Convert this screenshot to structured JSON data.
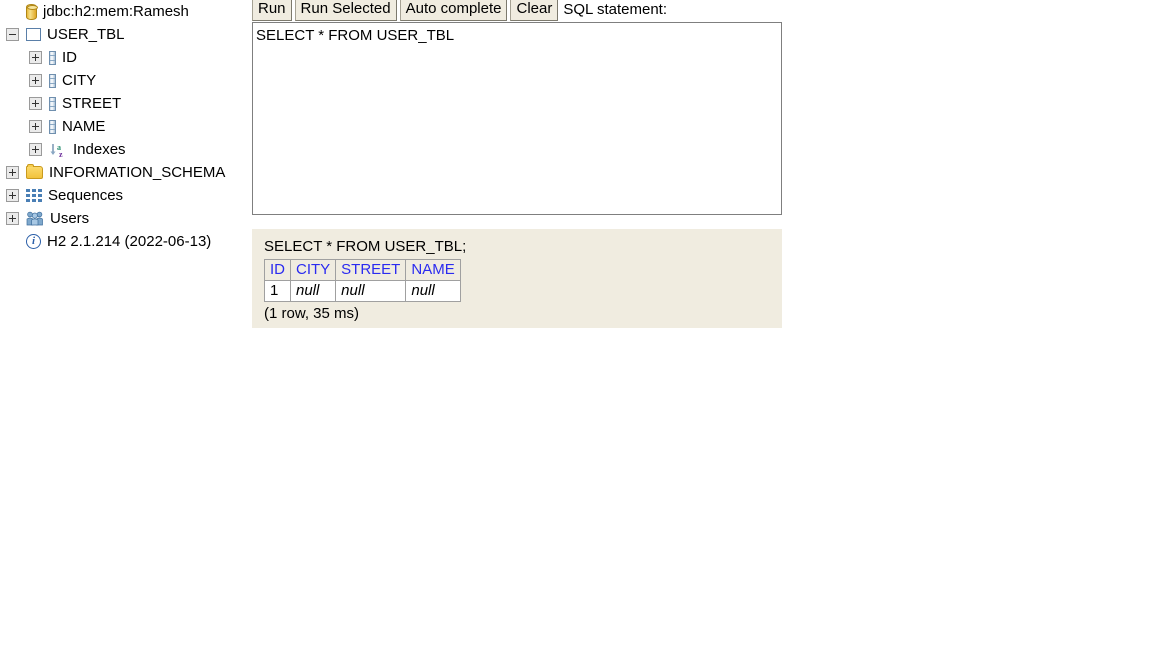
{
  "sidebar": {
    "tree": [
      {
        "label": "jdbc:h2:mem:Ramesh",
        "icon": "database-icon",
        "level": 0,
        "toggle": "none"
      },
      {
        "label": "USER_TBL",
        "icon": "table-icon",
        "level": 1,
        "toggle": "minus"
      },
      {
        "label": "ID",
        "icon": "column-icon",
        "level": 2,
        "toggle": "plus"
      },
      {
        "label": "CITY",
        "icon": "column-icon",
        "level": 2,
        "toggle": "plus"
      },
      {
        "label": "STREET",
        "icon": "column-icon",
        "level": 2,
        "toggle": "plus"
      },
      {
        "label": "NAME",
        "icon": "column-icon",
        "level": 2,
        "toggle": "plus"
      },
      {
        "label": "Indexes",
        "icon": "index-sort-icon",
        "level": 2,
        "toggle": "plus"
      },
      {
        "label": "INFORMATION_SCHEMA",
        "icon": "folder-icon",
        "level": 1,
        "toggle": "plus"
      },
      {
        "label": "Sequences",
        "icon": "sequences-icon",
        "level": 1,
        "toggle": "plus"
      },
      {
        "label": "Users",
        "icon": "users-icon",
        "level": 1,
        "toggle": "plus"
      },
      {
        "label": "H2 2.1.214 (2022-06-13)",
        "icon": "info-icon",
        "level": 1,
        "toggle": "none"
      }
    ]
  },
  "toolbar": {
    "run_label": "Run",
    "run_selected_label": "Run Selected",
    "auto_complete_label": "Auto complete",
    "clear_label": "Clear",
    "sql_statement_label": "SQL statement:"
  },
  "editor": {
    "sql": "SELECT * FROM USER_TBL"
  },
  "results": {
    "query": "SELECT * FROM USER_TBL;",
    "columns": [
      "ID",
      "CITY",
      "STREET",
      "NAME"
    ],
    "rows": [
      [
        "1",
        "null",
        "null",
        "null"
      ]
    ],
    "status": "(1 row, 35 ms)"
  },
  "colors": {
    "header_text": "#2b2bf0",
    "panel_bg": "#f0ece0",
    "editor_bg": "#ffffff"
  }
}
